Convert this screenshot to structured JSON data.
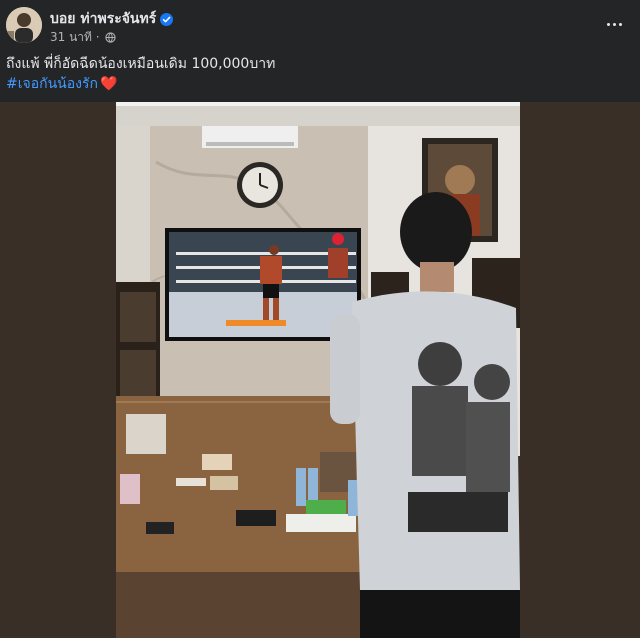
{
  "post": {
    "author": "บอย ท่าพระจันทร์",
    "time": "31 นาที",
    "caption": "ถึงแพ้ พี่ก็อัดฉีดน้องเหมือนเดิม 100,000บาท",
    "hashtag": "#เจอกันน้องรัก",
    "heart": "❤️",
    "verified_icon": "verified-badge-icon",
    "privacy_icon": "globe-icon",
    "more_icon": "more-options-icon"
  },
  "colors": {
    "background": "#242526",
    "text": "#e4e6eb",
    "secondary_text": "#b0b3b8",
    "link": "#4599ff",
    "verified": "#1877f2"
  }
}
